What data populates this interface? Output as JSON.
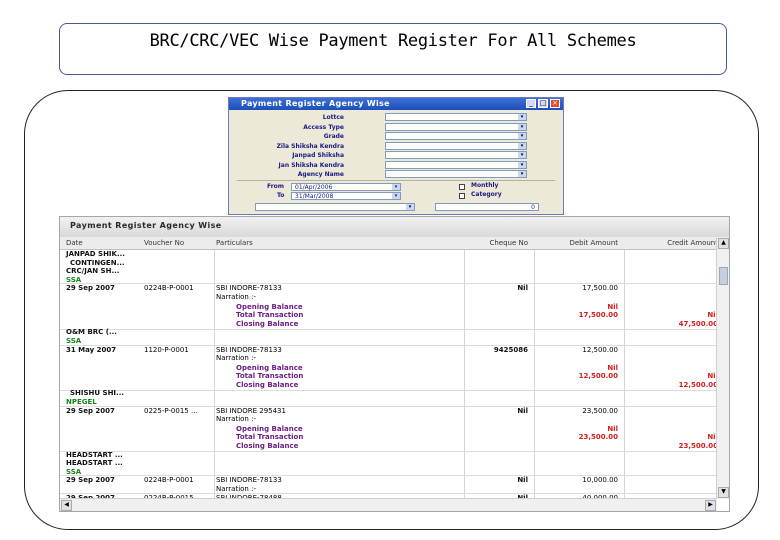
{
  "slide_title": "BRC/CRC/VEC Wise Payment  Register  For All Schemes",
  "dialog": {
    "title": "Payment Register Agency Wise",
    "fields": [
      "Lottce",
      "Access Type",
      "Grade",
      "Zila Shiksha Kendra",
      "Janpad Shiksha",
      "Jan Shiksha Kendra",
      "Agency Name"
    ],
    "from_label": "From",
    "from_value": "01/Apr/2006",
    "to_label": "To",
    "to_value": "31/Mar/2008",
    "monthly_label": "Monthly",
    "category_label": "Category",
    "amount_value": "0",
    "ok_label": "✓",
    "close_label": "✕"
  },
  "report": {
    "title": "Payment Register Agency Wise",
    "columns": [
      "Date",
      "Voucher No",
      "Particulars",
      "Cheque No",
      "Debit Amount",
      "Credit Amount"
    ],
    "rows": [
      {
        "type": "agency",
        "date": "JANPAD SHIK..."
      },
      {
        "type": "agency",
        "date": "CONTINGEN..."
      },
      {
        "type": "agency",
        "date": "CRC/JAN SH..."
      },
      {
        "type": "scheme",
        "date": "SSA"
      },
      {
        "type": "entry",
        "date": "29 Sep 2007",
        "voucher": "0224B-P-0001",
        "particulars": "SBI INDORE-78133",
        "cheque": "Nil",
        "debit": "17,500.00",
        "credit": ""
      },
      {
        "type": "narr",
        "particulars": "Narration :-"
      },
      {
        "type": "sum",
        "particulars": "Opening Balance",
        "debit": "Nil",
        "credit": ""
      },
      {
        "type": "sum",
        "particulars": "Total Transaction",
        "debit": "17,500.00",
        "credit": "Nil"
      },
      {
        "type": "sum",
        "particulars": "Closing Balance",
        "debit": "",
        "credit": "47,500.00"
      },
      {
        "type": "agency",
        "date": "O&M BRC (..."
      },
      {
        "type": "scheme",
        "date": "SSA"
      },
      {
        "type": "entry",
        "date": "31 May 2007",
        "voucher": "1120-P-0001",
        "particulars": "SBI INDORE-78133",
        "cheque": "9425086",
        "debit": "12,500.00",
        "credit": ""
      },
      {
        "type": "narr",
        "particulars": "Narration :-"
      },
      {
        "type": "sum",
        "particulars": "Opening Balance",
        "debit": "Nil",
        "credit": ""
      },
      {
        "type": "sum",
        "particulars": "Total Transaction",
        "debit": "12,500.00",
        "credit": "Nil"
      },
      {
        "type": "sum",
        "particulars": "Closing Balance",
        "debit": "",
        "credit": "12,500.00"
      },
      {
        "type": "agency",
        "date": "SHISHU SHI..."
      },
      {
        "type": "scheme",
        "date": "NPEGEL"
      },
      {
        "type": "entry",
        "date": "29 Sep 2007",
        "voucher": "0225-P-0015 ...",
        "particulars": "SBI INDORE 295431",
        "cheque": "Nil",
        "debit": "23,500.00",
        "credit": ""
      },
      {
        "type": "narr",
        "particulars": "Narration :-"
      },
      {
        "type": "sum",
        "particulars": "Opening Balance",
        "debit": "Nil",
        "credit": ""
      },
      {
        "type": "sum",
        "particulars": "Total Transaction",
        "debit": "23,500.00",
        "credit": "Nil"
      },
      {
        "type": "sum",
        "particulars": "Closing Balance",
        "debit": "",
        "credit": "23,500.00"
      },
      {
        "type": "agency",
        "date": "HEADSTART ..."
      },
      {
        "type": "agency",
        "date": "HEADSTART ..."
      },
      {
        "type": "scheme",
        "date": "SSA"
      },
      {
        "type": "entry",
        "date": "29 Sep 2007",
        "voucher": "0224B-P-0001",
        "particulars": "SBI INDORE-78133",
        "cheque": "Nil",
        "debit": "10,000.00",
        "credit": ""
      },
      {
        "type": "narr",
        "particulars": "Narration :-"
      },
      {
        "type": "entry",
        "date": "29 Sep 2007",
        "voucher": "0224B-P-0015 ...",
        "particulars": "SBI INDORE-78488",
        "cheque": "Nil",
        "debit": "40,000.00",
        "credit": ""
      }
    ]
  }
}
